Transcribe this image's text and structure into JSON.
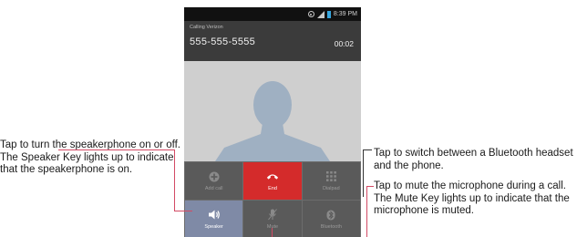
{
  "status_bar": {
    "time": "8:39 PM",
    "icons": [
      "gps-icon",
      "signal-icon",
      "battery-icon"
    ]
  },
  "call": {
    "status": "Calling Verizon",
    "number": "555-555-5555",
    "timer": "00:02"
  },
  "keys": [
    {
      "label": "Add call",
      "icon": "add-call-icon"
    },
    {
      "label": "End",
      "icon": "end-call-icon"
    },
    {
      "label": "Dialpad",
      "icon": "dialpad-icon"
    },
    {
      "label": "Speaker",
      "icon": "speaker-icon"
    },
    {
      "label": "Mute",
      "icon": "mute-icon"
    },
    {
      "label": "Bluetooth",
      "icon": "bluetooth-icon"
    }
  ],
  "callouts": {
    "speaker": "Tap to turn the speakerphone on or off. The Speaker Key lights up to indicate that the speakerphone is on.",
    "bluetooth": "Tap to switch between a Bluetooth headset and the phone.",
    "mute": "Tap to mute the microphone during a call. The Mute Key lights up to indicate that the microphone is muted."
  },
  "colors": {
    "end_key": "#d42b2b",
    "speaker_key": "#7f8aa6",
    "leader_line": "#d34a65",
    "header_bg": "#3b3b3b"
  }
}
